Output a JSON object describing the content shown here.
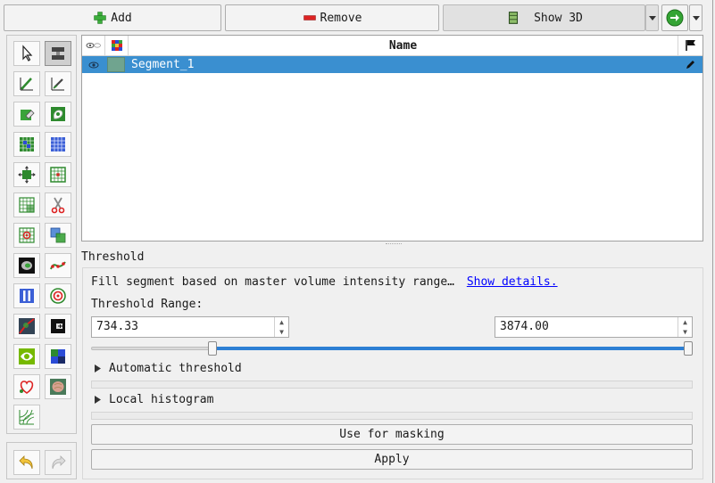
{
  "toolbar": {
    "add_label": "Add",
    "remove_label": "Remove",
    "show3d_label": "Show 3D"
  },
  "table": {
    "headers": {
      "visibility": "",
      "color": "",
      "name": "Name",
      "status": ""
    },
    "rows": [
      {
        "name": "Segment_1",
        "color": "#70a48f",
        "selected": true
      }
    ]
  },
  "effect": {
    "title": "Threshold",
    "description": "Fill segment based on master volume intensity range…",
    "show_details_link": "Show details.",
    "range_label": "Threshold Range:",
    "min_value": "734.33",
    "max_value": "3874.00",
    "slider_min_fraction": 0.198,
    "slider_max_fraction": 1.0,
    "automatic_threshold_label": "Automatic threshold",
    "local_histogram_label": "Local histogram",
    "use_for_masking_label": "Use for masking",
    "apply_label": "Apply"
  },
  "colors": {
    "selection": "#3a8fd0",
    "slider_fill": "#2d7fd4",
    "link": "#0000ff"
  }
}
